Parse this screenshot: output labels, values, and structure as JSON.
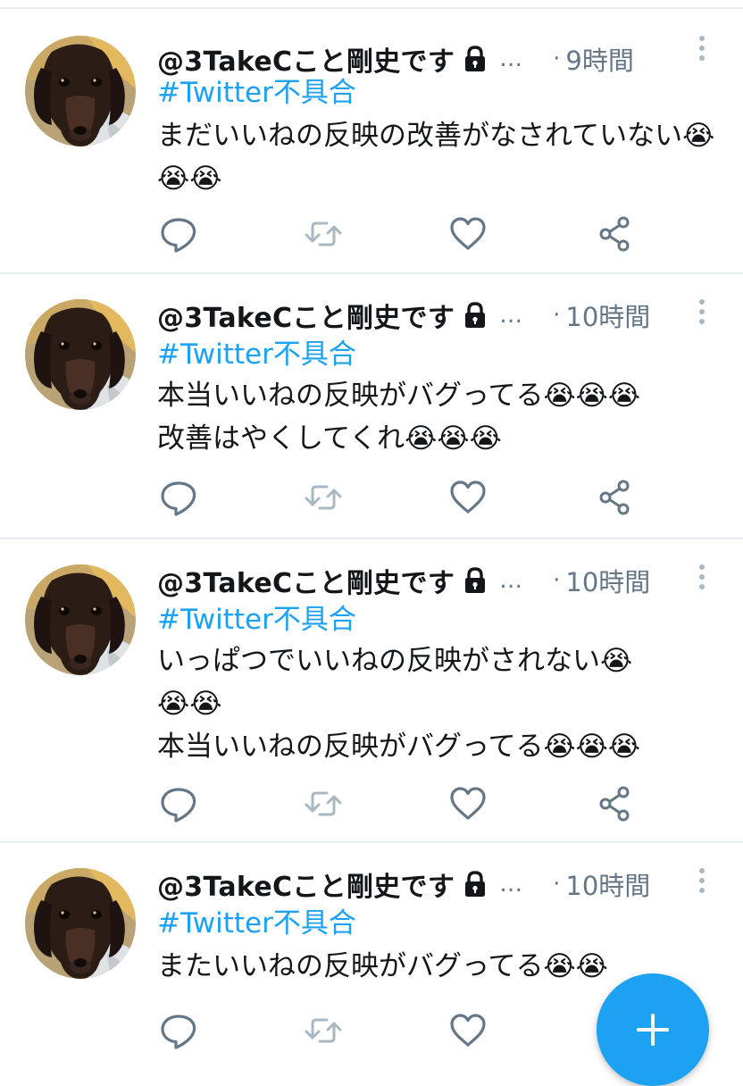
{
  "colors": {
    "accent": "#1da1f2",
    "text": "#14171a",
    "muted": "#657786",
    "icon": "#657786",
    "divider": "#e6ecf0"
  },
  "tweets": [
    {
      "display_name": "@3TakeCこと剛史です",
      "ellipsis": "…",
      "dot": "·",
      "time": "9時間",
      "hashtag": "#Twitter不具合",
      "body": "まだいいねの反映の改善がなされていない😭😭😭"
    },
    {
      "display_name": "@3TakeCこと剛史です",
      "ellipsis": "…",
      "dot": "·",
      "time": "10時間",
      "hashtag": "#Twitter不具合",
      "body": "本当いいねの反映がバグってる😭😭😭\n改善はやくしてくれ😭😭😭"
    },
    {
      "display_name": "@3TakeCこと剛史です",
      "ellipsis": "…",
      "dot": "·",
      "time": "10時間",
      "hashtag": "#Twitter不具合",
      "body": "いっぱつでいいねの反映がされない😭\n😭😭\n本当いいねの反映がバグってる😭😭😭"
    },
    {
      "display_name": "@3TakeCこと剛史です",
      "ellipsis": "…",
      "dot": "·",
      "time": "10時間",
      "hashtag": "#Twitter不具合",
      "body": "またいいねの反映がバグってる😭😭"
    }
  ],
  "icons": {
    "lock": "lock-icon",
    "reply": "reply-icon",
    "retweet": "retweet-icon",
    "like": "heart-icon",
    "share": "share-icon",
    "more": "more-vertical-icon",
    "compose": "plus-icon"
  }
}
